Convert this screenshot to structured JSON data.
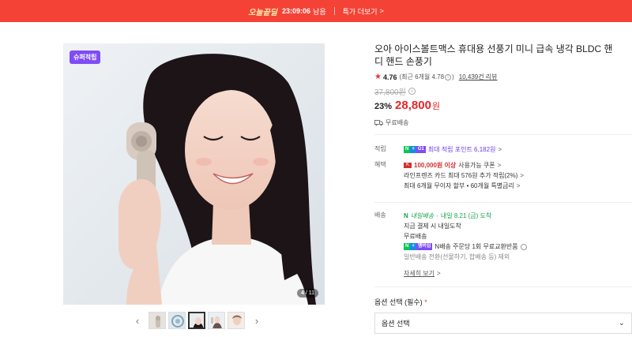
{
  "promo_bar": {
    "badge": "오늘끝딜",
    "timer": "23:09:06",
    "remaining": "남음",
    "more": "특가 더보기",
    "more_chevron": ">"
  },
  "gallery": {
    "badge": "슈퍼적립",
    "counter_current": "4",
    "counter_total": "/ 11",
    "prev_icon": "chevron-left-icon",
    "next_icon": "chevron-right-icon",
    "thumbnail_count": 5,
    "active_thumbnail": 3
  },
  "product": {
    "title": "오아 아이스볼트맥스 휴대용 선풍기 미니 급속 냉각 BLDC 핸디 핸드 손풍기",
    "rating_star": "★",
    "rating": "4.76",
    "rating_recent": "(최근 6개월 4.78",
    "rating_recent_close": ")",
    "info_glyph": "i",
    "reviews": "10,439건 리뷰",
    "original_price": "37,800원",
    "discount_rate": "23%",
    "price": "28,800",
    "currency": "원",
    "shipping": "무료배송"
  },
  "benefits": {
    "points_label": "적립",
    "npay_n": "N",
    "npay_plus": "+",
    "npay_membership": "G1",
    "points_text": "최대 적립 포인트 6,182원",
    "chevron": ">",
    "benefit_label": "혜택",
    "coupon_flag": "K",
    "coupon_highlight": "100,000원 이상",
    "coupon_text": "사용가능 쿠폰",
    "card_text": "라인프렌즈 카드 최대 576원 추가 적립(2%)",
    "installment_text": "최대 6개월 무이자 할부 • 60개월 특별금리"
  },
  "delivery": {
    "label": "배송",
    "arrival_icon": "N",
    "arrival_label": "내일배송",
    "arrival_sep": "·",
    "arrival_date": "내일 8.21 (금) 도착",
    "pay_now": "지금 결제 시 내일도착",
    "free": "무료배송",
    "npay_n": "N",
    "npay_plus": "+",
    "npay_membership": "멤버십",
    "return_text": "N배송 주문당 1회 무료교환반품",
    "note": "일반배송 전환(선물하기, 합배송 등) 제외",
    "detail_link": "자세히 보기",
    "chevron": ">"
  },
  "options": {
    "label": "옵션 선택 (필수)",
    "required_mark": "*",
    "select_value": "옵션 선택",
    "caret": "⌄"
  }
}
